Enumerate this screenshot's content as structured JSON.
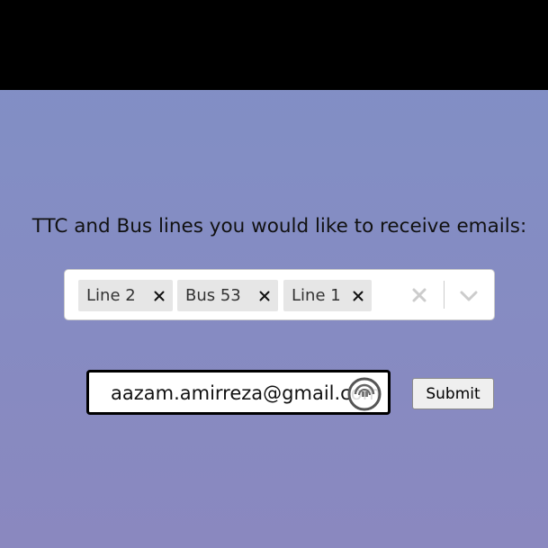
{
  "page": {
    "heading": "TTC and Bus lines you would like to receive emails:"
  },
  "lines_select": {
    "selected": [
      {
        "label": "Line 2"
      },
      {
        "label": "Bus 53"
      },
      {
        "label": "Line 1"
      }
    ],
    "icons": {
      "remove": "close-icon",
      "clear": "close-icon",
      "dropdown": "chevron-down-icon"
    }
  },
  "email_form": {
    "email_value": "aazam.amirreza@gmail.com",
    "submit_label": "Submit",
    "autofill_icon": "autofill-icon"
  },
  "colors": {
    "top_bar": "#000000",
    "background_top": "#8090c6",
    "background_bottom": "#8a88bf",
    "chip_background": "#e6e6e6",
    "control_border": "#cccccc"
  }
}
